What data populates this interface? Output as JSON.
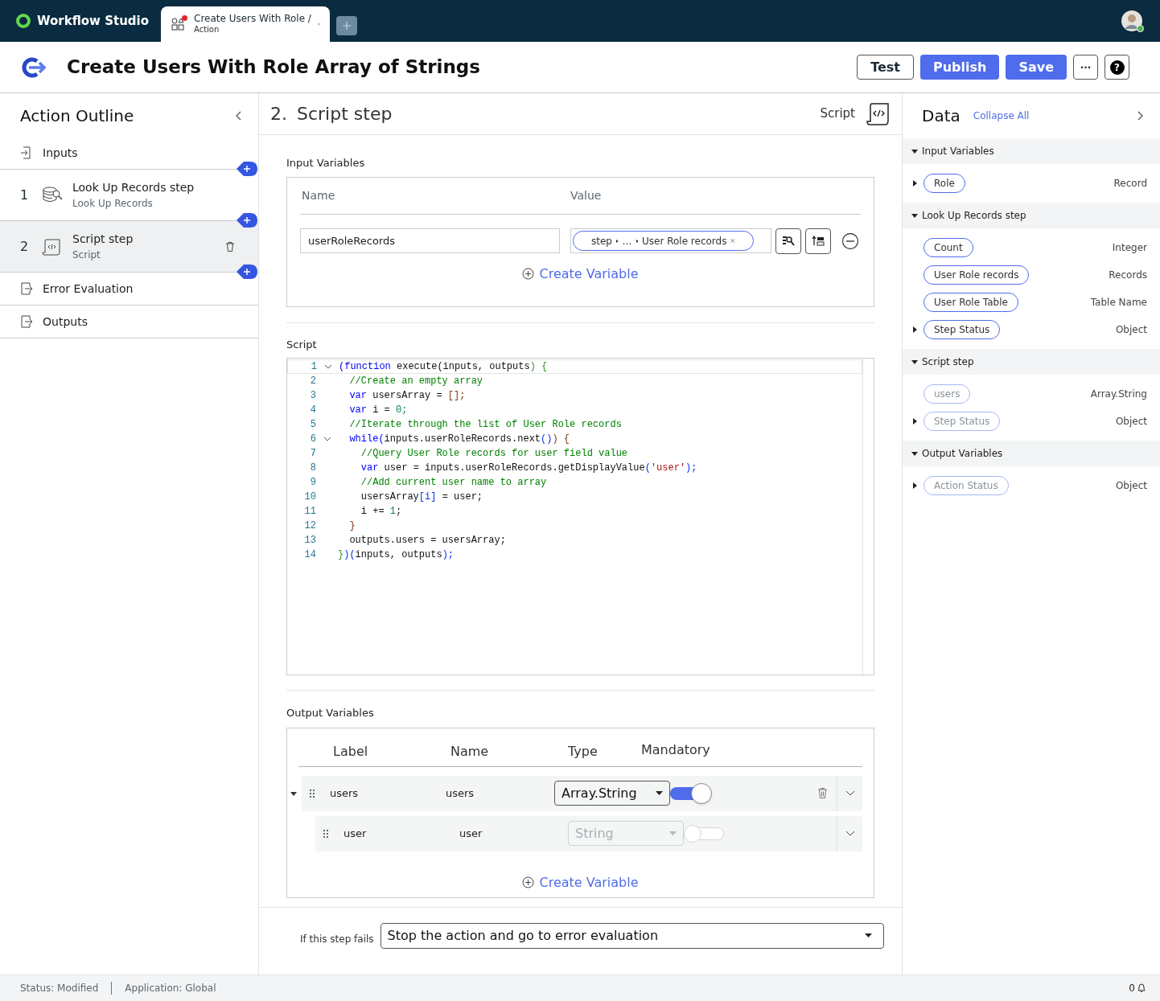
{
  "app": {
    "name": "Workflow Studio"
  },
  "tabs": [
    {
      "title": "Create Users With Role /",
      "subtitle": "Action",
      "selected": true,
      "modified": true
    }
  ],
  "header": {
    "title": "Create Users With Role Array of Strings",
    "buttons": [
      {
        "label": "Test",
        "kind": "outline"
      },
      {
        "label": "Publish",
        "kind": "primary"
      },
      {
        "label": "Save",
        "kind": "primary"
      },
      {
        "label": "···",
        "kind": "more"
      },
      {
        "label": "?",
        "kind": "help"
      }
    ]
  },
  "outline": {
    "title": "Action Outline",
    "items": [
      {
        "kind": "io",
        "label": "Inputs",
        "selected": false
      },
      {
        "kind": "step",
        "number": "1",
        "label": "Look Up Records step",
        "sub": "Look Up Records",
        "selected": false
      },
      {
        "kind": "step",
        "number": "2",
        "label": "Script step",
        "sub": "Script",
        "selected": true
      },
      {
        "kind": "io",
        "label": "Error Evaluation",
        "selected": false
      },
      {
        "kind": "io",
        "label": "Outputs",
        "selected": false
      }
    ]
  },
  "step": {
    "number": "2.",
    "title": "Script step",
    "type": "Script",
    "input_variables": {
      "label": "Input Variables",
      "columns": [
        "Name",
        "Value"
      ],
      "rows": [
        {
          "name": "userRoleRecords",
          "pill": [
            "step",
            "…",
            "User Role records"
          ]
        }
      ],
      "create": "Create Variable"
    },
    "script": {
      "label": "Script",
      "lines": [
        {
          "n": "1",
          "fold": true,
          "tokens": [
            {
              "text": "(function",
              "color": "#0000ff"
            },
            {
              "text": " execute(inputs, outputs",
              "color": "#111111"
            },
            {
              "text": ") {",
              "color": "#319331"
            }
          ]
        },
        {
          "n": "2",
          "fold": false,
          "tokens": [
            {
              "text": "  //Create an empty array",
              "color": "#008000"
            }
          ]
        },
        {
          "n": "3",
          "fold": false,
          "tokens": [
            {
              "text": "  var",
              "color": "#0000ff"
            },
            {
              "text": " usersArray = ",
              "color": "#111111"
            },
            {
              "text": "[];",
              "color": "#7b3814"
            }
          ]
        },
        {
          "n": "4",
          "fold": false,
          "tokens": [
            {
              "text": "  var",
              "color": "#0000ff"
            },
            {
              "text": " i = ",
              "color": "#111111"
            },
            {
              "text": "0;",
              "color": "#098658"
            }
          ]
        },
        {
          "n": "5",
          "fold": false,
          "tokens": [
            {
              "text": "  //Iterate through the list of User Role records",
              "color": "#008000"
            }
          ]
        },
        {
          "n": "6",
          "fold": true,
          "tokens": [
            {
              "text": "  while(",
              "color": "#0000ff"
            },
            {
              "text": "inputs.userRoleRecords.next",
              "color": "#111111"
            },
            {
              "text": "()",
              "color": "#0431fa"
            },
            {
              "text": ") {",
              "color": "#7b3814"
            }
          ]
        },
        {
          "n": "7",
          "fold": false,
          "tokens": [
            {
              "text": "    //Query User Role records for user field value",
              "color": "#008000"
            }
          ]
        },
        {
          "n": "8",
          "fold": false,
          "tokens": [
            {
              "text": "    var",
              "color": "#0000ff"
            },
            {
              "text": " user = inputs.userRoleRecords.getDisplayValue",
              "color": "#111111"
            },
            {
              "text": "(",
              "color": "#0431fa"
            },
            {
              "text": "'user'",
              "color": "#a31515"
            },
            {
              "text": ");",
              "color": "#0431fa"
            }
          ]
        },
        {
          "n": "9",
          "fold": false,
          "tokens": [
            {
              "text": "    //Add current user name to array",
              "color": "#008000"
            }
          ]
        },
        {
          "n": "10",
          "fold": false,
          "tokens": [
            {
              "text": "    usersArray",
              "color": "#111111"
            },
            {
              "text": "[i]",
              "color": "#0431fa"
            },
            {
              "text": " = user;",
              "color": "#111111"
            }
          ]
        },
        {
          "n": "11",
          "fold": false,
          "tokens": [
            {
              "text": "    i += ",
              "color": "#111111"
            },
            {
              "text": "1",
              "color": "#098658"
            },
            {
              "text": ";",
              "color": "#111111"
            }
          ]
        },
        {
          "n": "12",
          "fold": false,
          "tokens": [
            {
              "text": "  }",
              "color": "#7b3814"
            }
          ]
        },
        {
          "n": "13",
          "fold": false,
          "tokens": [
            {
              "text": "  outputs.users = usersArray;",
              "color": "#111111"
            }
          ]
        },
        {
          "n": "14",
          "fold": false,
          "tokens": [
            {
              "text": "}",
              "color": "#319331"
            },
            {
              "text": ")(",
              "color": "#0431fa"
            },
            {
              "text": "inputs, outputs",
              "color": "#111111"
            },
            {
              "text": ");",
              "color": "#0431fa"
            }
          ]
        }
      ]
    },
    "output_variables": {
      "label": "Output Variables",
      "columns": [
        "Label",
        "Name",
        "Type",
        "Mandatory"
      ],
      "rows": [
        {
          "label": "users",
          "name": "users",
          "type": "Array.String",
          "mandatory": true,
          "disabled": false,
          "expanded": true,
          "children": [
            {
              "label": "user",
              "name": "user",
              "type": "String",
              "mandatory": false,
              "disabled": true
            }
          ]
        }
      ],
      "create": "Create Variable"
    },
    "on_failure": {
      "label": "If this step fails",
      "value": "Stop the action and go to error evaluation"
    }
  },
  "data_panel": {
    "title": "Data",
    "collapse": "Collapse All",
    "sections": [
      {
        "title": "Input Variables",
        "items": [
          {
            "pill": "Role",
            "type": "Record",
            "expandable": true,
            "disabled": false
          }
        ]
      },
      {
        "title": "Look Up Records step",
        "items": [
          {
            "pill": "Count",
            "type": "Integer",
            "expandable": false,
            "disabled": false
          },
          {
            "pill": "User Role records",
            "type": "Records",
            "expandable": false,
            "disabled": false
          },
          {
            "pill": "User Role Table",
            "type": "Table Name",
            "expandable": false,
            "disabled": false
          },
          {
            "pill": "Step Status",
            "type": "Object",
            "expandable": true,
            "disabled": false
          }
        ]
      },
      {
        "title": "Script step",
        "items": [
          {
            "pill": "users",
            "type": "Array.String",
            "expandable": false,
            "disabled": true
          },
          {
            "pill": "Step Status",
            "type": "Object",
            "expandable": true,
            "disabled": true
          }
        ]
      },
      {
        "title": "Output Variables",
        "items": [
          {
            "pill": "Action Status",
            "type": "Object",
            "expandable": true,
            "disabled": true
          }
        ]
      }
    ]
  },
  "status_bar": {
    "status": "Status: Modified",
    "application": "Application: Global",
    "notifications": "0"
  }
}
